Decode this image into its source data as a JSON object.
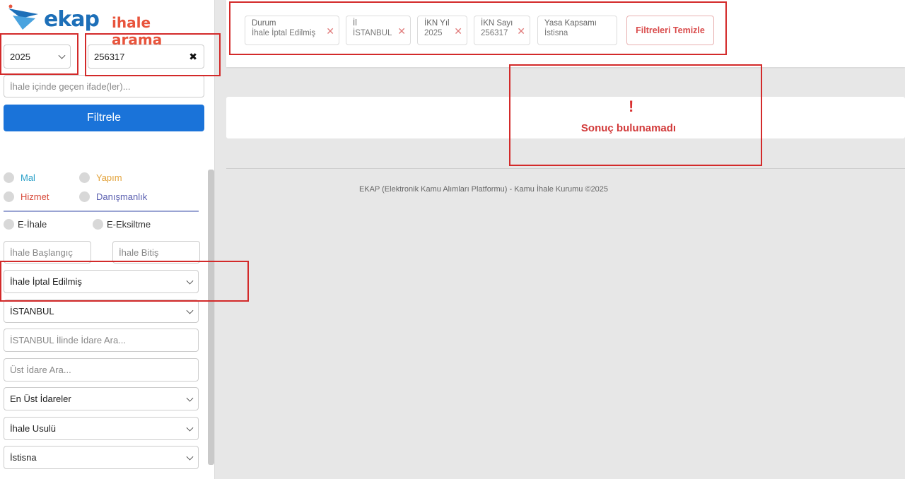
{
  "logo": {
    "word": "ekap",
    "sub": "ihale arama"
  },
  "filters": {
    "year": "2025",
    "ikn": "256317",
    "search_placeholder": "İhale içinde geçen ifade(ler)...",
    "filter_button": "Filtrele",
    "types": [
      "Mal",
      "Yapım",
      "Hizmet",
      "Danışmanlık"
    ],
    "methods": [
      "E-İhale",
      "E-Eksiltme"
    ],
    "start_placeholder": "İhale Başlangıç",
    "end_placeholder": "İhale Bitiş",
    "status": "İhale İptal Edilmiş",
    "city": "İSTANBUL",
    "admin_placeholder": "İSTANBUL İlinde İdare Ara...",
    "upper_admin_placeholder": "Üst İdare Ara...",
    "top_admins": "En Üst İdareler",
    "procedure": "İhale Usulü",
    "scope": "İstisna"
  },
  "chips": [
    {
      "title": "Durum",
      "value": "İhale İptal Edilmiş"
    },
    {
      "title": "İl",
      "value": "İSTANBUL"
    },
    {
      "title": "İKN Yıl",
      "value": "2025"
    },
    {
      "title": "İKN Sayı",
      "value": "256317"
    },
    {
      "title": "Yasa Kapsamı",
      "value": "İstisna"
    }
  ],
  "clear_button": "Filtreleri Temizle",
  "result": {
    "icon": "!",
    "message": "Sonuç bulunamadı"
  },
  "footer": "EKAP (Elektronik Kamu Alımları Platformu) - Kamu İhale Kurumu ©2025",
  "colors": {
    "primary": "#1a73d9",
    "danger": "#d32a2a",
    "mal": "#2aa0c8",
    "yapim": "#e3a33b",
    "hizmet": "#d84a3a",
    "danismanlik": "#5a5fb0"
  },
  "icons": [
    "ekap-logo-icon",
    "chevron-down-icon",
    "clear-x-icon",
    "remove-chip-icon",
    "warning-icon"
  ]
}
